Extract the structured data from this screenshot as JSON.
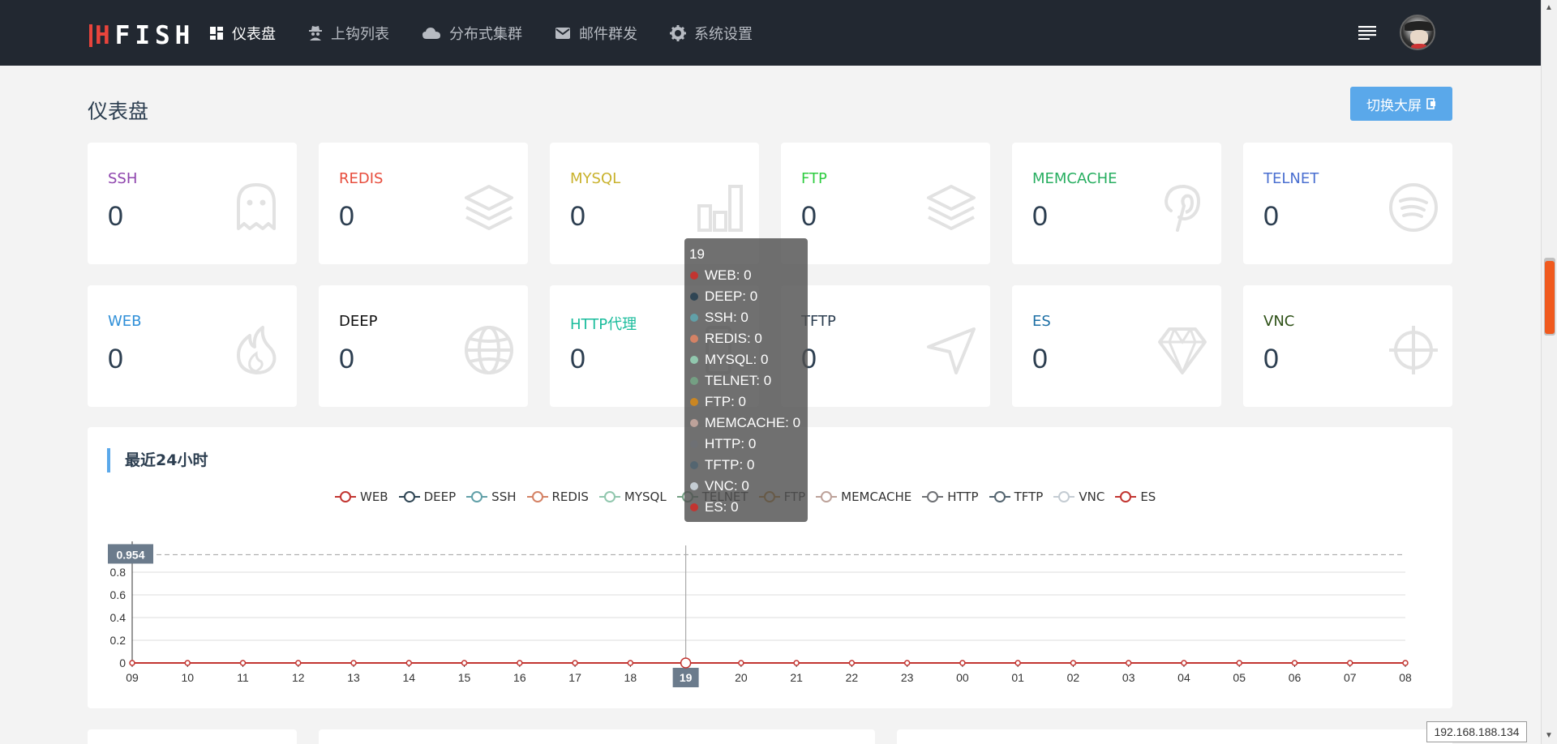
{
  "nav": {
    "logo_text": "HFISH",
    "items": [
      {
        "label": "仪表盘",
        "icon": "dashboard-icon"
      },
      {
        "label": "上钩列表",
        "icon": "spy-icon"
      },
      {
        "label": "分布式集群",
        "icon": "cloud-icon"
      },
      {
        "label": "邮件群发",
        "icon": "mail-icon"
      },
      {
        "label": "系统设置",
        "icon": "gear-icon"
      }
    ]
  },
  "page": {
    "title": "仪表盘",
    "switch_button": "切换大屏"
  },
  "cards": [
    {
      "label": "SSH",
      "value": "0",
      "color": "#8e44ad",
      "icon": "ghost-icon"
    },
    {
      "label": "REDIS",
      "value": "0",
      "color": "#e74c3c",
      "icon": "layers-icon"
    },
    {
      "label": "MYSQL",
      "value": "0",
      "color": "#c9b22c",
      "icon": "bar-chart-icon"
    },
    {
      "label": "FTP",
      "value": "0",
      "color": "#2ecc40",
      "icon": "layers-icon"
    },
    {
      "label": "MEMCACHE",
      "value": "0",
      "color": "#27ae60",
      "icon": "pinterest-icon"
    },
    {
      "label": "TELNET",
      "value": "0",
      "color": "#4a6fd0",
      "icon": "spotify-icon"
    },
    {
      "label": "WEB",
      "value": "0",
      "color": "#2f8fd8",
      "icon": "fire-icon"
    },
    {
      "label": "DEEP",
      "value": "0",
      "color": "#111111",
      "icon": "globe-icon"
    },
    {
      "label": "HTTP代理",
      "value": "0",
      "color": "#1abc9c",
      "icon": "mobile-icon"
    },
    {
      "label": "TFTP",
      "value": "0",
      "color": "#2c3e50",
      "icon": "send-icon"
    },
    {
      "label": "ES",
      "value": "0",
      "color": "#1d6fa5",
      "icon": "diamond-icon"
    },
    {
      "label": "VNC",
      "value": "0",
      "color": "#2d5016",
      "icon": "crosshair-icon"
    }
  ],
  "chart_panel": {
    "title": "最近24小时"
  },
  "chart_data": {
    "type": "line",
    "categories": [
      "09",
      "10",
      "11",
      "12",
      "13",
      "14",
      "15",
      "16",
      "17",
      "18",
      "19",
      "20",
      "21",
      "22",
      "23",
      "00",
      "01",
      "02",
      "03",
      "04",
      "05",
      "06",
      "07",
      "08"
    ],
    "series": [
      {
        "name": "WEB",
        "color": "#c23531",
        "values": [
          0,
          0,
          0,
          0,
          0,
          0,
          0,
          0,
          0,
          0,
          0,
          0,
          0,
          0,
          0,
          0,
          0,
          0,
          0,
          0,
          0,
          0,
          0,
          0
        ]
      },
      {
        "name": "DEEP",
        "color": "#2f4554",
        "values": [
          0,
          0,
          0,
          0,
          0,
          0,
          0,
          0,
          0,
          0,
          0,
          0,
          0,
          0,
          0,
          0,
          0,
          0,
          0,
          0,
          0,
          0,
          0,
          0
        ]
      },
      {
        "name": "SSH",
        "color": "#61a0a8",
        "values": [
          0,
          0,
          0,
          0,
          0,
          0,
          0,
          0,
          0,
          0,
          0,
          0,
          0,
          0,
          0,
          0,
          0,
          0,
          0,
          0,
          0,
          0,
          0,
          0
        ]
      },
      {
        "name": "REDIS",
        "color": "#d48265",
        "values": [
          0,
          0,
          0,
          0,
          0,
          0,
          0,
          0,
          0,
          0,
          0,
          0,
          0,
          0,
          0,
          0,
          0,
          0,
          0,
          0,
          0,
          0,
          0,
          0
        ]
      },
      {
        "name": "MYSQL",
        "color": "#91c7ae",
        "values": [
          0,
          0,
          0,
          0,
          0,
          0,
          0,
          0,
          0,
          0,
          0,
          0,
          0,
          0,
          0,
          0,
          0,
          0,
          0,
          0,
          0,
          0,
          0,
          0
        ]
      },
      {
        "name": "TELNET",
        "color": "#749f83",
        "values": [
          0,
          0,
          0,
          0,
          0,
          0,
          0,
          0,
          0,
          0,
          0,
          0,
          0,
          0,
          0,
          0,
          0,
          0,
          0,
          0,
          0,
          0,
          0,
          0
        ]
      },
      {
        "name": "FTP",
        "color": "#ca8622",
        "values": [
          0,
          0,
          0,
          0,
          0,
          0,
          0,
          0,
          0,
          0,
          0,
          0,
          0,
          0,
          0,
          0,
          0,
          0,
          0,
          0,
          0,
          0,
          0,
          0
        ]
      },
      {
        "name": "MEMCACHE",
        "color": "#bda29a",
        "values": [
          0,
          0,
          0,
          0,
          0,
          0,
          0,
          0,
          0,
          0,
          0,
          0,
          0,
          0,
          0,
          0,
          0,
          0,
          0,
          0,
          0,
          0,
          0,
          0
        ]
      },
      {
        "name": "HTTP",
        "color": "#6e7074",
        "values": [
          0,
          0,
          0,
          0,
          0,
          0,
          0,
          0,
          0,
          0,
          0,
          0,
          0,
          0,
          0,
          0,
          0,
          0,
          0,
          0,
          0,
          0,
          0,
          0
        ]
      },
      {
        "name": "TFTP",
        "color": "#546570",
        "values": [
          0,
          0,
          0,
          0,
          0,
          0,
          0,
          0,
          0,
          0,
          0,
          0,
          0,
          0,
          0,
          0,
          0,
          0,
          0,
          0,
          0,
          0,
          0,
          0
        ]
      },
      {
        "name": "VNC",
        "color": "#c4ccd3",
        "values": [
          0,
          0,
          0,
          0,
          0,
          0,
          0,
          0,
          0,
          0,
          0,
          0,
          0,
          0,
          0,
          0,
          0,
          0,
          0,
          0,
          0,
          0,
          0,
          0
        ]
      },
      {
        "name": "ES",
        "color": "#c23531",
        "values": [
          0,
          0,
          0,
          0,
          0,
          0,
          0,
          0,
          0,
          0,
          0,
          0,
          0,
          0,
          0,
          0,
          0,
          0,
          0,
          0,
          0,
          0,
          0,
          0
        ]
      }
    ],
    "ylim": [
      0,
      1
    ],
    "yticks": [
      "0",
      "0.2",
      "0.4",
      "0.6",
      "0.8"
    ],
    "pointer_value": "0.954",
    "highlight_category": "19",
    "grid": true,
    "legend_position": "top-center"
  },
  "tooltip": {
    "title": "19",
    "rows": [
      {
        "text": "WEB: 0",
        "color": "#c23531"
      },
      {
        "text": "DEEP: 0",
        "color": "#2f4554"
      },
      {
        "text": "SSH: 0",
        "color": "#61a0a8"
      },
      {
        "text": "REDIS: 0",
        "color": "#d48265"
      },
      {
        "text": "MYSQL: 0",
        "color": "#91c7ae"
      },
      {
        "text": "TELNET: 0",
        "color": "#749f83"
      },
      {
        "text": "FTP: 0",
        "color": "#ca8622"
      },
      {
        "text": "MEMCACHE: 0",
        "color": "#bda29a"
      },
      {
        "text": "HTTP: 0",
        "color": "#6e7074"
      },
      {
        "text": "TFTP: 0",
        "color": "#546570"
      },
      {
        "text": "VNC: 0",
        "color": "#c4ccd3"
      },
      {
        "text": "ES: 0",
        "color": "#c23531"
      }
    ]
  },
  "status": {
    "ip": "192.168.188.134"
  }
}
